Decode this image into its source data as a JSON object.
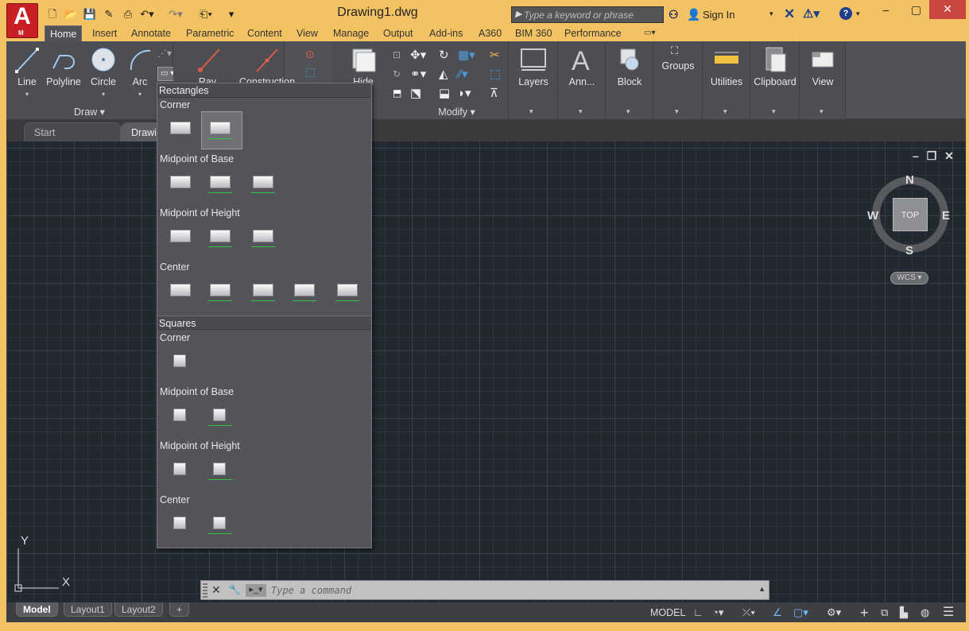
{
  "app": {
    "logo": "A",
    "logo_sub": "M"
  },
  "title": "Drawing1.dwg",
  "search": {
    "placeholder": "Type a keyword or phrase"
  },
  "account": {
    "sign_in": "Sign In"
  },
  "ribbon_tabs": [
    "Home",
    "Insert",
    "Annotate",
    "Parametric",
    "Content",
    "View",
    "Manage",
    "Output",
    "Add-ins",
    "A360",
    "BIM 360",
    "Performance"
  ],
  "draw_panel": {
    "label": "Draw",
    "tools": [
      "Line",
      "Polyline",
      "Circle",
      "Arc"
    ],
    "partial_tools": [
      "Ray",
      "Construction"
    ]
  },
  "hide_label": "Hide",
  "modify_panel": {
    "label": "Modify"
  },
  "big_panels": [
    "Layers",
    "Ann...",
    "Block",
    "Groups",
    "Utilities",
    "Clipboard",
    "View"
  ],
  "file_tabs": [
    "Start",
    "Drawin"
  ],
  "viewcube": {
    "top": "TOP",
    "n": "N",
    "s": "S",
    "e": "E",
    "w": "W",
    "wcs": "WCS"
  },
  "ucs": {
    "x": "X",
    "y": "Y"
  },
  "command": {
    "placeholder": "Type a command"
  },
  "layout_tabs": [
    "Model",
    "Layout1",
    "Layout2"
  ],
  "status": {
    "model": "MODEL"
  },
  "rect_dropdown": {
    "rect_header": "Rectangles",
    "rect_sections": [
      "Corner",
      "Midpoint of Base",
      "Midpoint of Height",
      "Center"
    ],
    "square_header": "Squares",
    "square_sections": [
      "Corner",
      "Midpoint of Base",
      "Midpoint of Height",
      "Center"
    ]
  },
  "colors": {
    "accent": "#f3c363",
    "ribbon": "#505257",
    "canvas": "#212830",
    "app_red": "#c81f25"
  }
}
